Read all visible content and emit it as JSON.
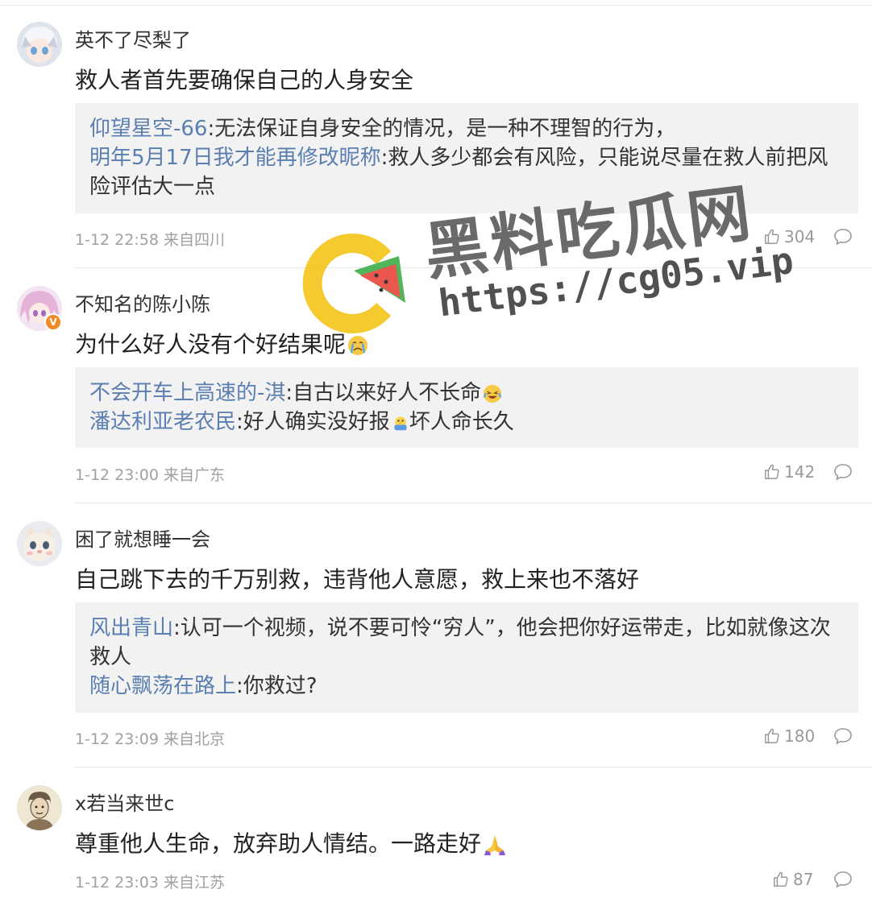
{
  "comments": [
    {
      "username": "英不了尽梨了",
      "text": "救人者首先要确保自己的人身安全",
      "replies": [
        {
          "name": "仰望星空-66",
          "text": ":无法保证自身安全的情况，是一种不理智的行为，"
        },
        {
          "name": "明年5月17日我才能再修改昵称",
          "text": ":救人多少都会有风险，只能说尽量在救人前把风险评估大一点"
        }
      ],
      "meta": "1-12 22:58 来自四川",
      "likes": "304"
    },
    {
      "username": "不知名的陈小陈",
      "text": "为什么好人没有个好结果呢",
      "replies": [
        {
          "name": "不会开车上高速的-淇",
          "text": ":自古以来好人不长命"
        },
        {
          "name": "潘达利亚老农民",
          "text": ":好人确实没好报",
          "text2": "坏人命长久"
        }
      ],
      "meta": "1-12 23:00 来自广东",
      "likes": "142"
    },
    {
      "username": "困了就想睡一会",
      "text": "自己跳下去的千万别救，违背他人意愿，救上来也不落好",
      "replies": [
        {
          "name": "风出青山",
          "text": ":认可一个视频，说不要可怜“穷人”，他会把你好运带走，比如就像这次救人"
        },
        {
          "name": "随心飘荡在路上",
          "text": ":你救过?"
        }
      ],
      "meta": "1-12 23:09 来自北京",
      "likes": "180"
    },
    {
      "username": "x若当来世c",
      "text": "尊重他人生命，放弃助人情结。一路走好",
      "replies": [],
      "meta": "1-12 23:03 来自江苏",
      "likes": "87"
    }
  ],
  "watermark": {
    "title": "黑料吃瓜网",
    "url": "https://cg05.vip"
  },
  "colors": {
    "reply_name": "#5b7fb0",
    "meta": "#a0a0a0",
    "reply_bg": "#f2f2f2",
    "verified_badge": "#f08a24"
  },
  "icons": {
    "like": "thumbs-up-icon",
    "reply": "comment-bubble-icon",
    "verified": "verified-badge-icon"
  }
}
